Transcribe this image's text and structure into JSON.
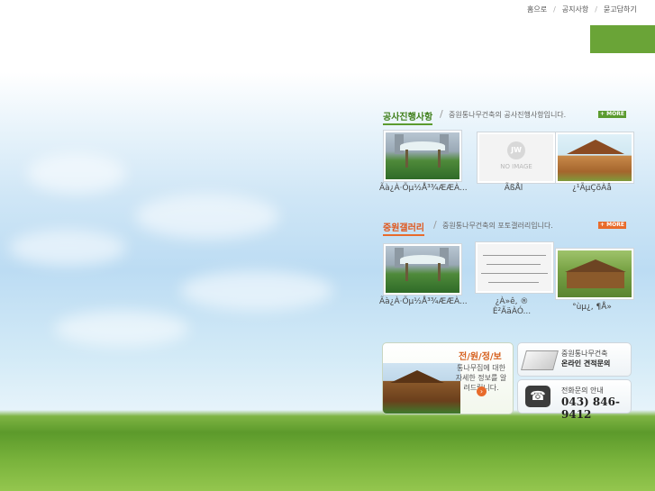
{
  "top_nav": {
    "items": [
      {
        "label": "홈으로"
      },
      {
        "label": "공지사항"
      },
      {
        "label": "묻고답하기"
      }
    ],
    "separator": "/"
  },
  "construction": {
    "title": "공사진행사항",
    "description": "중원통나무건축의 공사진행사항입니다.",
    "more_label": "+ MORE",
    "items": [
      {
        "caption_line1": "",
        "caption": "Ãà¿À·Õµ½Å³¾ÆÆÀ...",
        "image": "pavilion"
      },
      {
        "caption_line1": "",
        "caption": "ÃßÅl",
        "image": "no-image",
        "no_image_label": "NO IMAGE",
        "no_image_logo": "JW"
      },
      {
        "caption_line1": "",
        "caption": "¿¹ÃµÇõÀå",
        "image": "cabin"
      }
    ]
  },
  "gallery": {
    "title": "중원갤러리",
    "description": "중원통나무건축의 포토갤러리입니다.",
    "more_label": "+ MORE",
    "items": [
      {
        "caption_line1": "",
        "caption": "Ãà¿À·Õµ½Å³¾ÆÆÀ...",
        "image": "pavilion"
      },
      {
        "caption_line1": "¿À»ê, ®",
        "caption": "È²ÃäÀÓ...",
        "image": "sketch"
      },
      {
        "caption_line1": "",
        "caption": "°ùµ¿, ¶Å»",
        "image": "gazebo"
      }
    ]
  },
  "info_box": {
    "title": "전/원/정/보",
    "text": "통나무집에 대한 자세한 정보를 알려드립니다.",
    "arrow": "›"
  },
  "estimate_box": {
    "line1": "중원통나무건축",
    "line2": "온라인 견적문의"
  },
  "phone_box": {
    "line1": "전화문의 안내",
    "phone": "043) 846-9412",
    "icon_glyph": "☎"
  },
  "colors": {
    "green_accent": "#5b9b2f",
    "orange_accent": "#e86b2b",
    "top_green_box": "#6aa437"
  }
}
